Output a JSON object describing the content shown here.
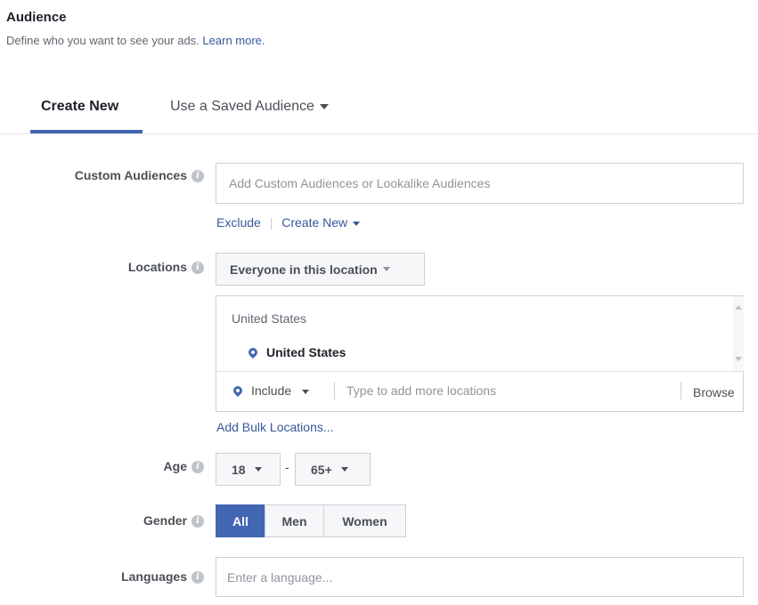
{
  "header": {
    "title": "Audience",
    "description": "Define who you want to see your ads.",
    "learn_more": "Learn more."
  },
  "tabs": [
    {
      "label": "Create New",
      "active": true
    },
    {
      "label": "Use a Saved Audience",
      "active": false
    }
  ],
  "custom_audiences": {
    "label": "Custom Audiences",
    "placeholder": "Add Custom Audiences or Lookalike Audiences",
    "exclude": "Exclude",
    "create_new": "Create New"
  },
  "locations": {
    "label": "Locations",
    "dropdown": "Everyone in this location",
    "group_heading": "United States",
    "selected": "United States",
    "include": "Include",
    "placeholder": "Type to add more locations",
    "browse": "Browse",
    "bulk": "Add Bulk Locations..."
  },
  "age": {
    "label": "Age",
    "min": "18",
    "dash": "-",
    "max": "65+"
  },
  "gender": {
    "label": "Gender",
    "options": [
      "All",
      "Men",
      "Women"
    ],
    "selected": "All"
  },
  "languages": {
    "label": "Languages",
    "placeholder": "Enter a language..."
  },
  "colors": {
    "accent": "#4267b2",
    "link": "#365899"
  }
}
